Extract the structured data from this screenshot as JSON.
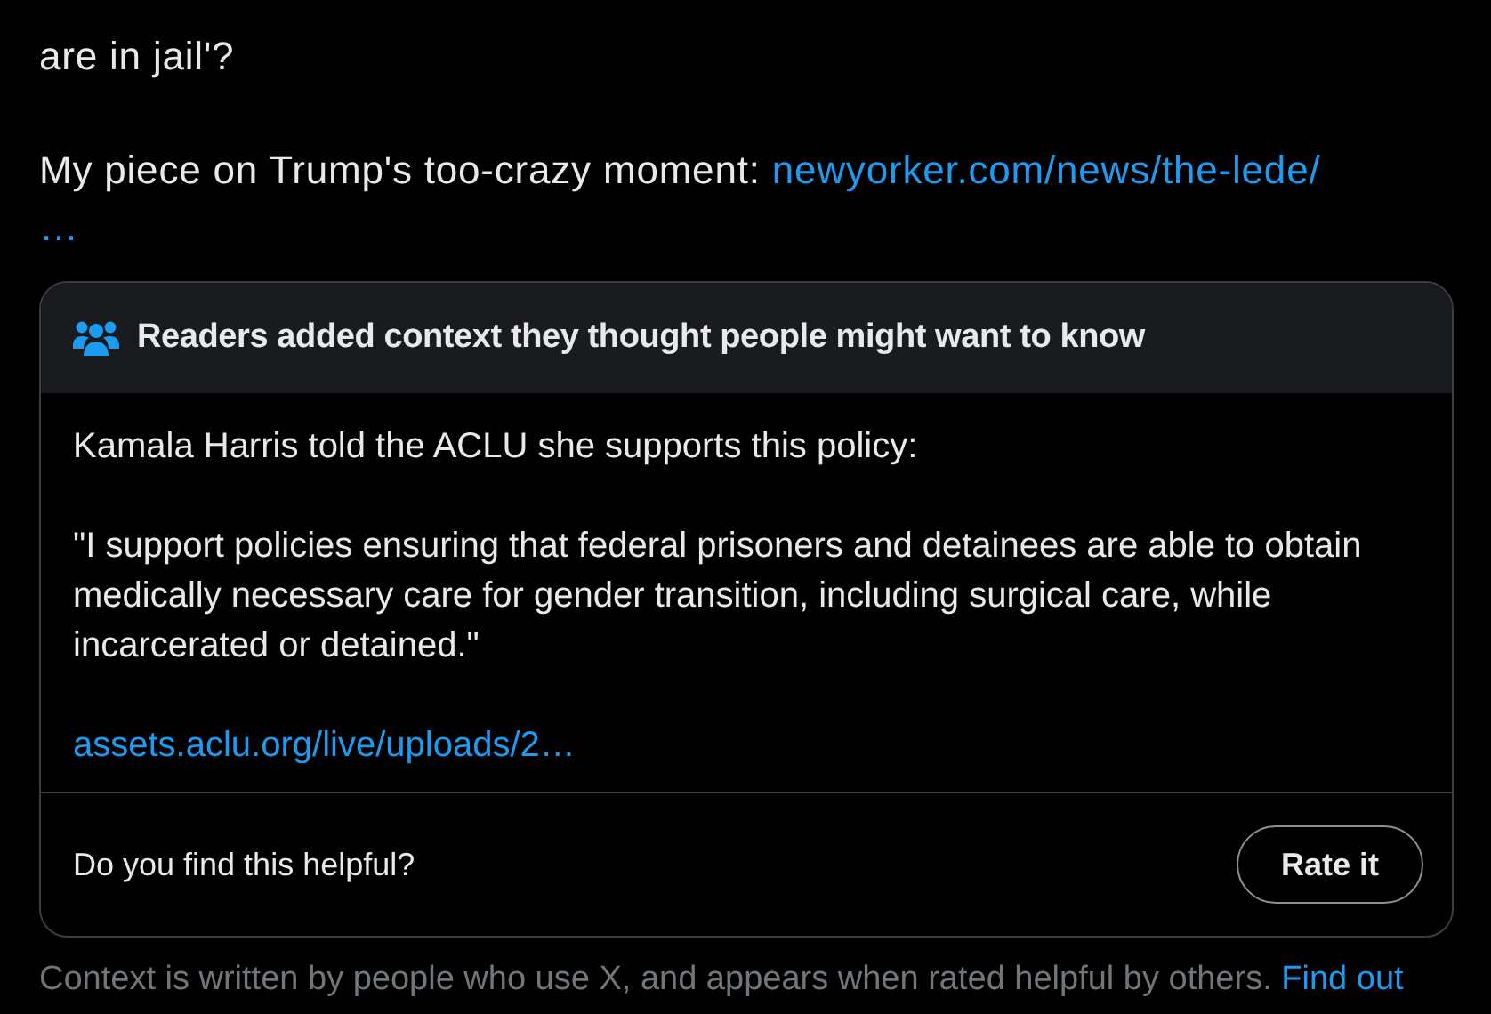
{
  "post": {
    "lines": [
      "are in jail'?"
    ],
    "piece_text": "My piece on Trump's too-crazy moment: ",
    "link": "newyorker.com/news/the-lede/",
    "link_ellipsis": "…"
  },
  "context_note": {
    "header": "Readers added context they thought people might want to know",
    "paragraphs": [
      "Kamala Harris told the ACLU she supports this policy:",
      "\"I support policies ensuring that federal prisoners and detainees are able to obtain medically necessary care for gender transition, including surgical care, while incarcerated or detained.\""
    ],
    "link": "assets.aclu.org/live/uploads/2…",
    "question": "Do you find this helpful?",
    "button": "Rate it"
  },
  "footnote": {
    "text": "Context is written by people who use X, and appears when rated helpful by others.",
    "link": "Find out"
  }
}
